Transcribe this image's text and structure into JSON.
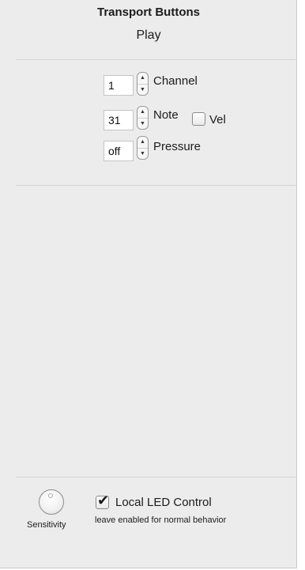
{
  "header": {
    "title": "Transport Buttons",
    "subtitle": "Play"
  },
  "controls": {
    "channel": {
      "value": "1",
      "label": "Channel"
    },
    "note": {
      "value": "31",
      "label": "Note",
      "vel_label": "Vel",
      "vel_checked": false
    },
    "pressure": {
      "value": "off",
      "label": "Pressure"
    }
  },
  "footer": {
    "knob_label": "Sensitivity",
    "local_led_label": "Local LED Control",
    "local_led_checked": true,
    "local_led_hint": "leave enabled for normal behavior"
  },
  "icons": {
    "stepper_up": "up-arrow-icon",
    "stepper_down": "down-arrow-icon",
    "knob": "knob-icon"
  }
}
